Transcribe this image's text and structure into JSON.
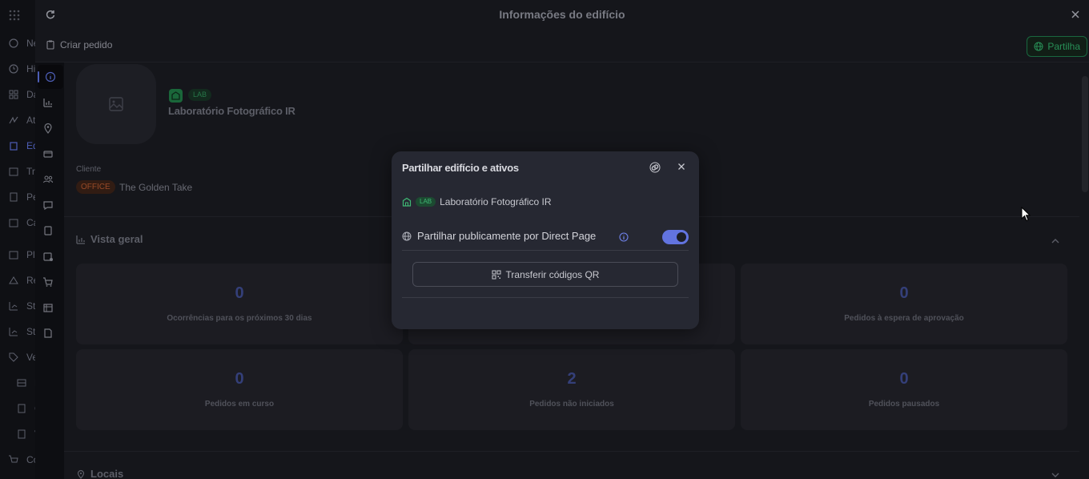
{
  "app_sidebar": {
    "items": [
      {
        "label": "Ne",
        "icon": "plus-circle-icon",
        "active": false
      },
      {
        "label": "Hi",
        "icon": "history-icon",
        "active": false
      },
      {
        "label": "Da",
        "icon": "dashboard-icon",
        "active": false
      },
      {
        "label": "At",
        "icon": "activity-icon",
        "active": false
      },
      {
        "label": "Ed",
        "icon": "building-icon",
        "active": true
      },
      {
        "label": "Tr",
        "icon": "calendar-icon",
        "active": false
      },
      {
        "label": "Pe",
        "icon": "clipboard-icon",
        "active": false
      },
      {
        "label": "Ca",
        "icon": "calendar-icon",
        "active": false
      },
      {
        "label": "Pl",
        "icon": "calendar-icon",
        "active": false
      },
      {
        "label": "Re",
        "icon": "scale-icon",
        "active": false
      },
      {
        "label": "St",
        "icon": "chart-icon",
        "active": false
      },
      {
        "label": "St",
        "icon": "chart-icon",
        "active": false
      },
      {
        "label": "Ve",
        "icon": "tag-icon",
        "active": false
      },
      {
        "label": "F",
        "icon": "table-icon",
        "active": false
      },
      {
        "label": "C",
        "icon": "doc-icon",
        "active": false
      },
      {
        "label": "V",
        "icon": "doc-icon",
        "active": false
      },
      {
        "label": "Co",
        "icon": "cart-icon",
        "active": false
      }
    ]
  },
  "drawer": {
    "title": "Informações do edifício",
    "create_order_label": "Criar pedido",
    "share_label": "Partilha",
    "building": {
      "tag": "LAB",
      "name": "Laboratório Fotográfico IR",
      "client_label": "Cliente",
      "client_tag": "OFFICE",
      "client_name": "The Golden Take"
    },
    "overview": {
      "title": "Vista geral",
      "stats": [
        {
          "value": "0",
          "label": "Ocorrências para os próximos 30 dias"
        },
        {
          "value": "",
          "label": ""
        },
        {
          "value": "0",
          "label": "Pedidos à espera de aprovação"
        },
        {
          "value": "0",
          "label": "Pedidos em curso"
        },
        {
          "value": "2",
          "label": "Pedidos não iniciados"
        },
        {
          "value": "0",
          "label": "Pedidos pausados"
        }
      ]
    },
    "locations": {
      "title": "Locais"
    }
  },
  "modal": {
    "title": "Partilhar edifício e ativos",
    "building_tag": "LAB",
    "building_name": "Laboratório Fotográfico IR",
    "public_share_label": "Partilhar publicamente por Direct Page",
    "public_share_enabled": true,
    "qr_button_label": "Transferir códigos QR"
  },
  "colors": {
    "accent": "#6274e0",
    "success": "#2fa866",
    "warning": "#b4572e",
    "stat_value": "#3e4b8f"
  }
}
